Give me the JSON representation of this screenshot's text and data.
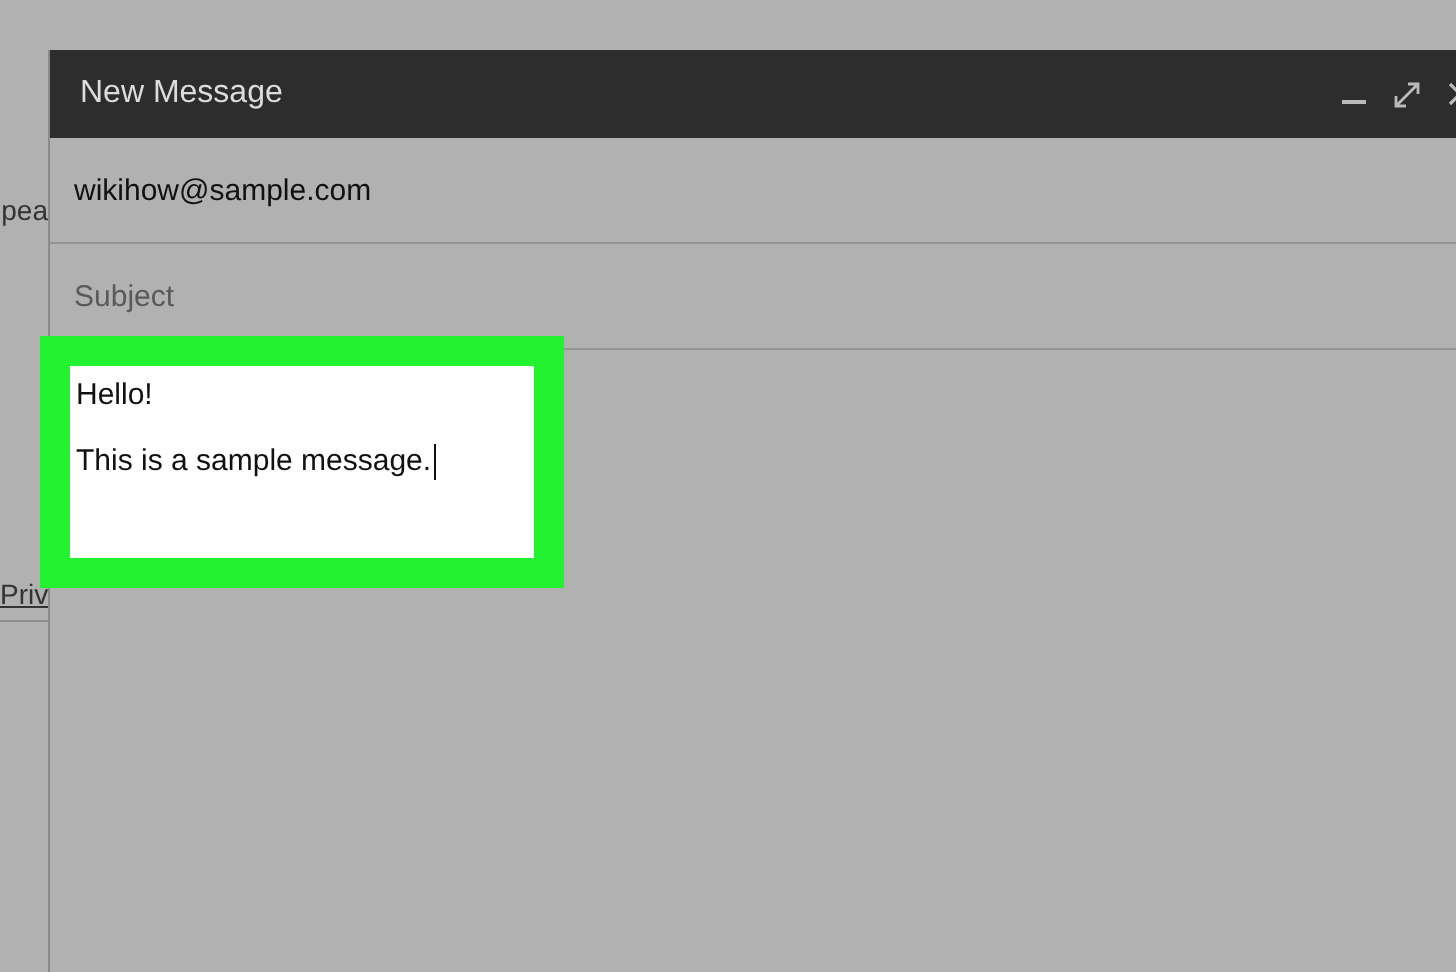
{
  "sidebar": {
    "texts": [
      {
        "text": "pea",
        "kind": "plain"
      },
      {
        "text": "Priv",
        "kind": "link"
      }
    ]
  },
  "compose": {
    "title": "New Message",
    "to": {
      "value": "wikihow@sample.com"
    },
    "subject": {
      "placeholder": "Subject"
    },
    "body": {
      "highlighted": true,
      "lines": [
        "Hello!",
        "This is a sample message."
      ]
    }
  }
}
